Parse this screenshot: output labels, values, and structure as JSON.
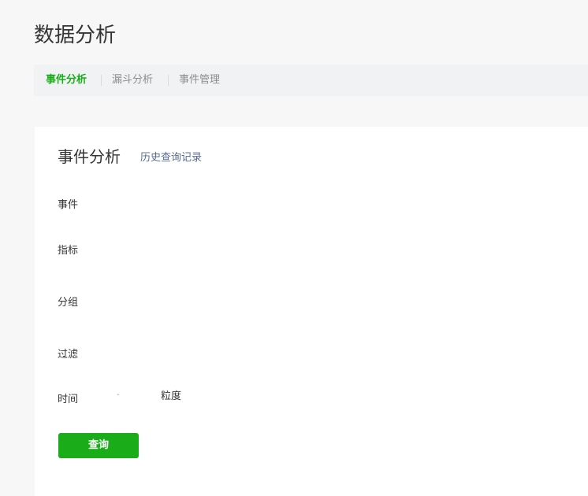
{
  "page": {
    "title": "数据分析"
  },
  "tabs": [
    {
      "label": "事件分析",
      "active": true
    },
    {
      "label": "漏斗分析",
      "active": false
    },
    {
      "label": "事件管理",
      "active": false
    }
  ],
  "card": {
    "title": "事件分析",
    "history_link": "历史查询记录"
  },
  "form": {
    "event_label": "事件",
    "metric_label": "指标",
    "group_label": "分组",
    "filter_label": "过滤",
    "time_label": "时间",
    "range_separator": "-",
    "granularity_label": "粒度",
    "query_button": "查询"
  },
  "colors": {
    "accent": "#1aad19",
    "link": "#576b95",
    "page_background": "#f7f7f8",
    "tabbar_background": "#f1f2f4"
  }
}
